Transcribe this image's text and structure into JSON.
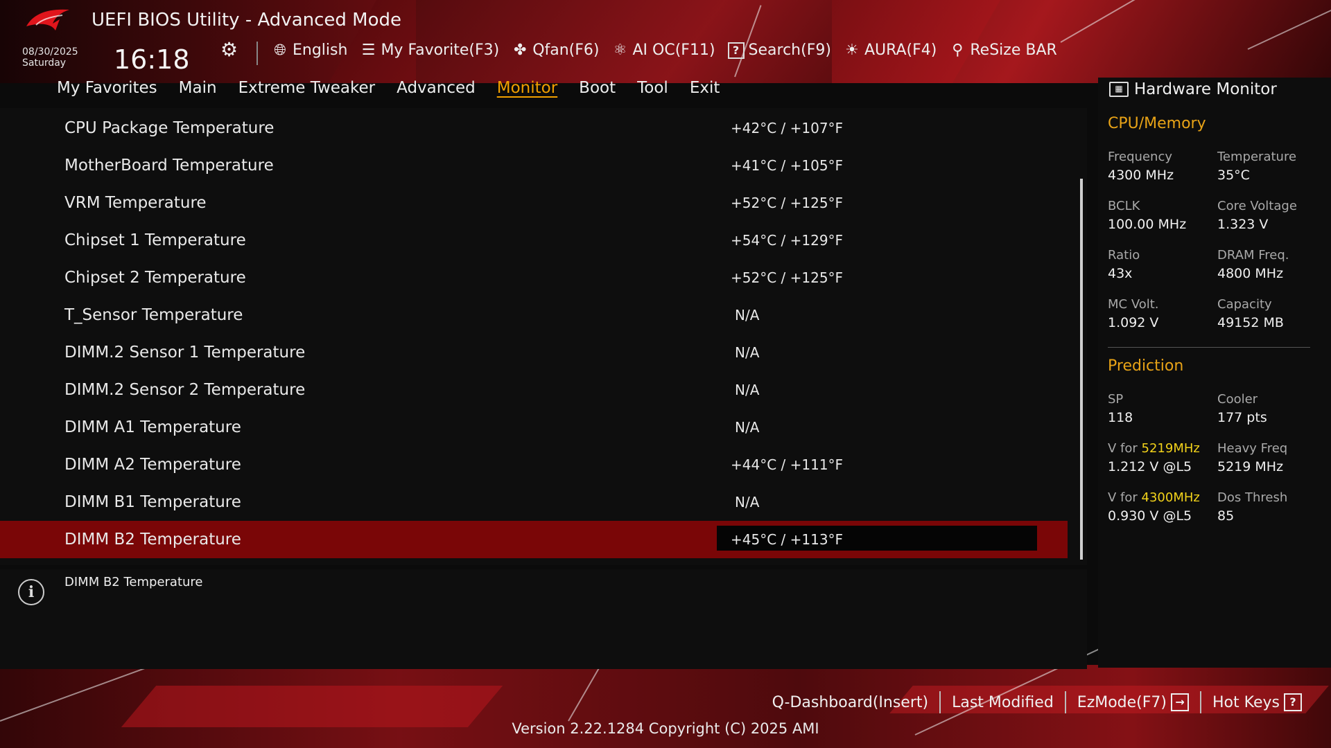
{
  "header": {
    "title": "UEFI BIOS Utility - Advanced Mode",
    "date": "08/30/2025",
    "day": "Saturday",
    "time": "16:18",
    "toolbar": [
      {
        "icon": "globe-icon",
        "label": "English"
      },
      {
        "icon": "favorite-list-icon",
        "label": "My Favorite(F3)"
      },
      {
        "icon": "fan-icon",
        "label": "Qfan(F6)"
      },
      {
        "icon": "ai-oc-icon",
        "label": "AI OC(F11)"
      },
      {
        "icon": "search-help-icon",
        "label": "Search(F9)"
      },
      {
        "icon": "aura-icon",
        "label": "AURA(F4)"
      },
      {
        "icon": "resize-bar-icon",
        "label": "ReSize BAR"
      }
    ]
  },
  "tabs": [
    {
      "label": "My Favorites",
      "active": false
    },
    {
      "label": "Main",
      "active": false
    },
    {
      "label": "Extreme Tweaker",
      "active": false
    },
    {
      "label": "Advanced",
      "active": false
    },
    {
      "label": "Monitor",
      "active": true
    },
    {
      "label": "Boot",
      "active": false
    },
    {
      "label": "Tool",
      "active": false
    },
    {
      "label": "Exit",
      "active": false
    }
  ],
  "rows": [
    {
      "label": "CPU Package Temperature",
      "value": "+42°C / +107°F"
    },
    {
      "label": "MotherBoard Temperature",
      "value": "+41°C / +105°F"
    },
    {
      "label": "VRM Temperature",
      "value": "+52°C / +125°F"
    },
    {
      "label": "Chipset 1 Temperature",
      "value": "+54°C / +129°F"
    },
    {
      "label": "Chipset 2 Temperature",
      "value": "+52°C / +125°F"
    },
    {
      "label": "T_Sensor Temperature",
      "value": "N/A"
    },
    {
      "label": "DIMM.2 Sensor 1 Temperature",
      "value": "N/A"
    },
    {
      "label": "DIMM.2 Sensor 2 Temperature",
      "value": "N/A"
    },
    {
      "label": "DIMM A1 Temperature",
      "value": "N/A"
    },
    {
      "label": "DIMM A2 Temperature",
      "value": "+44°C / +111°F"
    },
    {
      "label": "DIMM B1 Temperature",
      "value": "N/A"
    },
    {
      "label": "DIMM B2 Temperature",
      "value": "+45°C / +113°F",
      "selected": true
    }
  ],
  "help": {
    "text": "DIMM B2 Temperature"
  },
  "hardware_monitor": {
    "title": "Hardware Monitor",
    "cpu_memory": {
      "heading": "CPU/Memory",
      "frequency_label": "Frequency",
      "frequency": "4300 MHz",
      "temperature_label": "Temperature",
      "temperature": "35°C",
      "bclk_label": "BCLK",
      "bclk": "100.00 MHz",
      "core_voltage_label": "Core Voltage",
      "core_voltage": "1.323 V",
      "ratio_label": "Ratio",
      "ratio": "43x",
      "dram_freq_label": "DRAM Freq.",
      "dram_freq": "4800 MHz",
      "mc_volt_label": "MC Volt.",
      "mc_volt": "1.092 V",
      "capacity_label": "Capacity",
      "capacity": "49152 MB"
    },
    "prediction": {
      "heading": "Prediction",
      "sp_label": "SP",
      "sp": "118",
      "cooler_label": "Cooler",
      "cooler": "177 pts",
      "v_for_prefix": "V for ",
      "v_for_1_freq": "5219MHz",
      "v_for_1": "1.212 V @L5",
      "heavy_freq_label": "Heavy Freq",
      "heavy_freq": "5219 MHz",
      "v_for_2_freq": "4300MHz",
      "v_for_2": "0.930 V @L5",
      "dos_thresh_label": "Dos Thresh",
      "dos_thresh": "85"
    }
  },
  "footer": {
    "q_dashboard": "Q-Dashboard(Insert)",
    "last_modified": "Last Modified",
    "ezmode": "EzMode(F7)",
    "hot_keys": "Hot Keys",
    "version": "Version 2.22.1284 Copyright (C) 2025 AMI"
  },
  "colors": {
    "accent": "#f2a000",
    "selected_row": "#7a0607",
    "highlight": "#f2d21a"
  }
}
